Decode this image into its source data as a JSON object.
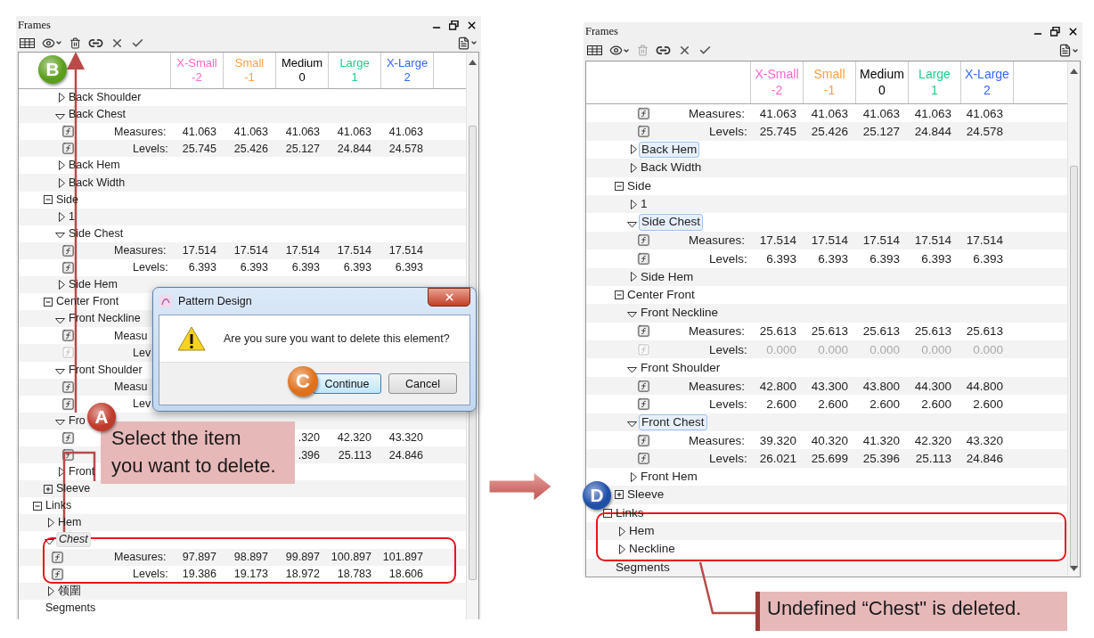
{
  "panels": [
    {
      "title": "Frames",
      "toolbar": [
        {
          "kind": "columns"
        },
        {
          "kind": "view"
        },
        {
          "kind": "delete",
          "disabled": false
        },
        {
          "kind": "link"
        },
        {
          "kind": "cancel"
        },
        {
          "kind": "apply"
        }
      ],
      "columns": [
        {
          "label": "X-Small",
          "sub": "-2",
          "color": "#ff66cc"
        },
        {
          "label": "Small",
          "sub": "-1",
          "color": "#ffa040"
        },
        {
          "label": "Medium",
          "sub": "0",
          "color": "#000000"
        },
        {
          "label": "Large",
          "sub": "1",
          "color": "#22cc88"
        },
        {
          "label": "X-Large",
          "sub": "2",
          "color": "#3366ff"
        }
      ],
      "tree": [
        {
          "kind": "group",
          "children": [
            {
              "kind": "group",
              "children": [
                {
                  "kind": "item",
                  "label": "Back Shoulder",
                  "expanded": false
                },
                {
                  "kind": "item",
                  "label": "Back Chest",
                  "expanded": true,
                  "children": [
                    {
                      "kind": "measures",
                      "label": "Measures:",
                      "disabled": false,
                      "values": [
                        "41.063",
                        "41.063",
                        "41.063",
                        "41.063",
                        "41.063"
                      ]
                    },
                    {
                      "kind": "levels",
                      "label": "Levels:",
                      "disabled": false,
                      "values": [
                        "25.745",
                        "25.426",
                        "25.127",
                        "24.844",
                        "24.578"
                      ]
                    }
                  ]
                },
                {
                  "kind": "item",
                  "label": "Back Hem",
                  "expanded": false
                },
                {
                  "kind": "item",
                  "label": "Back Width",
                  "expanded": false
                }
              ]
            },
            {
              "kind": "section",
              "label": "Side",
              "expanded": true,
              "children": [
                {
                  "kind": "item",
                  "label": "1",
                  "expanded": false
                },
                {
                  "kind": "item",
                  "label": "Side Chest",
                  "expanded": true,
                  "children": [
                    {
                      "kind": "measures",
                      "label": "Measures:",
                      "disabled": false,
                      "values": [
                        "17.514",
                        "17.514",
                        "17.514",
                        "17.514",
                        "17.514"
                      ]
                    },
                    {
                      "kind": "levels",
                      "label": "Levels:",
                      "disabled": false,
                      "values": [
                        "6.393",
                        "6.393",
                        "6.393",
                        "6.393",
                        "6.393"
                      ]
                    }
                  ]
                },
                {
                  "kind": "item",
                  "label": "Side Hem",
                  "expanded": false
                }
              ]
            },
            {
              "kind": "section",
              "label": "Center Front",
              "expanded": true,
              "children": [
                {
                  "kind": "item",
                  "label": "Front Neckline",
                  "expanded": true,
                  "children": [
                    {
                      "kind": "measures",
                      "label": "Measu",
                      "disabled": false
                    },
                    {
                      "kind": "levels",
                      "label": "Lev",
                      "disabled": true
                    }
                  ]
                },
                {
                  "kind": "item",
                  "label": "Front Shoulder",
                  "expanded": true,
                  "children": [
                    {
                      "kind": "measures",
                      "label": "Measu",
                      "disabled": false
                    },
                    {
                      "kind": "levels",
                      "label": "Lev",
                      "disabled": false
                    }
                  ]
                },
                {
                  "kind": "item",
                  "label": "Fro",
                  "expanded": true,
                  "children": [
                    {
                      "kind": "measures",
                      "disabled": false,
                      "values": [
                        ".320",
                        "42.320",
                        "43.320"
                      ]
                    },
                    {
                      "kind": "levels",
                      "disabled": false,
                      "values": [
                        ".396",
                        "25.113",
                        "24.846"
                      ]
                    }
                  ]
                },
                {
                  "kind": "item",
                  "label": "Front",
                  "expanded": false
                }
              ]
            },
            {
              "kind": "section",
              "label": "Sleeve",
              "expanded": false
            }
          ]
        },
        {
          "kind": "section",
          "label": "Links",
          "expanded": true,
          "children": [
            {
              "kind": "item",
              "label": "Hem",
              "expanded": false
            },
            {
              "kind": "item",
              "label": "Chest",
              "expanded": true,
              "undefined": true,
              "highlighted": true,
              "children": [
                {
                  "kind": "measures",
                  "label": "Measures:",
                  "disabled": false,
                  "values": [
                    "97.897",
                    "98.897",
                    "99.897",
                    "100.897",
                    "101.897"
                  ]
                },
                {
                  "kind": "levels",
                  "label": "Levels:",
                  "disabled": false,
                  "values": [
                    "19.386",
                    "19.173",
                    "18.972",
                    "18.783",
                    "18.606"
                  ]
                }
              ]
            },
            {
              "kind": "item",
              "label": "领圍",
              "expanded": false
            }
          ]
        },
        {
          "kind": "plain",
          "label": "Segments"
        }
      ],
      "dialog": {
        "title": "Pattern Design",
        "message": "Are you sure you want to delete this element?",
        "buttons": [
          {
            "label": "Continue",
            "default": true
          },
          {
            "label": "Cancel",
            "default": false
          }
        ]
      },
      "markers": [
        {
          "letter": "B",
          "color": "#5a9e1a"
        },
        {
          "letter": "A",
          "color": "#c0392b"
        },
        {
          "letter": "C",
          "color": "#e0701a"
        }
      ],
      "callout": "Select the item\nyou want to delete."
    },
    {
      "title": "Frames",
      "toolbar": [
        {
          "kind": "columns"
        },
        {
          "kind": "view"
        },
        {
          "kind": "delete",
          "disabled": true
        },
        {
          "kind": "link"
        },
        {
          "kind": "cancel"
        },
        {
          "kind": "apply"
        }
      ],
      "columns": [
        {
          "label": "X-Small",
          "sub": "-2",
          "color": "#ff66cc"
        },
        {
          "label": "Small",
          "sub": "-1",
          "color": "#ffa040"
        },
        {
          "label": "Medium",
          "sub": "0",
          "color": "#000000"
        },
        {
          "label": "Large",
          "sub": "1",
          "color": "#22cc88"
        },
        {
          "label": "X-Large",
          "sub": "2",
          "color": "#3366ff"
        }
      ],
      "tree": [
        {
          "kind": "group",
          "children": [
            {
              "kind": "group",
              "children": [
                {
                  "kind": "group",
                  "children": [
                    {
                      "kind": "measures",
                      "label": "Measures:",
                      "disabled": false,
                      "values": [
                        "41.063",
                        "41.063",
                        "41.063",
                        "41.063",
                        "41.063"
                      ]
                    },
                    {
                      "kind": "levels",
                      "label": "Levels:",
                      "disabled": false,
                      "values": [
                        "25.745",
                        "25.426",
                        "25.127",
                        "24.844",
                        "24.578"
                      ]
                    }
                  ]
                },
                {
                  "kind": "item",
                  "label": "Back Hem",
                  "expanded": false,
                  "highlighted": true
                },
                {
                  "kind": "item",
                  "label": "Back Width",
                  "expanded": false
                }
              ]
            },
            {
              "kind": "section",
              "label": "Side",
              "expanded": true,
              "children": [
                {
                  "kind": "item",
                  "label": "1",
                  "expanded": false
                },
                {
                  "kind": "item",
                  "label": "Side Chest",
                  "expanded": true,
                  "highlighted": true,
                  "children": [
                    {
                      "kind": "measures",
                      "label": "Measures:",
                      "disabled": false,
                      "values": [
                        "17.514",
                        "17.514",
                        "17.514",
                        "17.514",
                        "17.514"
                      ]
                    },
                    {
                      "kind": "levels",
                      "label": "Levels:",
                      "disabled": false,
                      "values": [
                        "6.393",
                        "6.393",
                        "6.393",
                        "6.393",
                        "6.393"
                      ]
                    }
                  ]
                },
                {
                  "kind": "item",
                  "label": "Side Hem",
                  "expanded": false
                }
              ]
            },
            {
              "kind": "section",
              "label": "Center Front",
              "expanded": true,
              "children": [
                {
                  "kind": "item",
                  "label": "Front Neckline",
                  "expanded": true,
                  "children": [
                    {
                      "kind": "measures",
                      "label": "Measures:",
                      "disabled": false,
                      "values": [
                        "25.613",
                        "25.613",
                        "25.613",
                        "25.613",
                        "25.613"
                      ]
                    },
                    {
                      "kind": "levels",
                      "label": "Levels:",
                      "disabled": true,
                      "values": [
                        "0.000",
                        "0.000",
                        "0.000",
                        "0.000",
                        "0.000"
                      ]
                    }
                  ]
                },
                {
                  "kind": "item",
                  "label": "Front Shoulder",
                  "expanded": true,
                  "children": [
                    {
                      "kind": "measures",
                      "label": "Measures:",
                      "disabled": false,
                      "values": [
                        "42.800",
                        "43.300",
                        "43.800",
                        "44.300",
                        "44.800"
                      ]
                    },
                    {
                      "kind": "levels",
                      "label": "Levels:",
                      "disabled": false,
                      "values": [
                        "2.600",
                        "2.600",
                        "2.600",
                        "2.600",
                        "2.600"
                      ]
                    }
                  ]
                },
                {
                  "kind": "item",
                  "label": "Front Chest",
                  "expanded": true,
                  "highlighted": true,
                  "children": [
                    {
                      "kind": "measures",
                      "label": "Measures:",
                      "disabled": false,
                      "values": [
                        "39.320",
                        "40.320",
                        "41.320",
                        "42.320",
                        "43.320"
                      ]
                    },
                    {
                      "kind": "levels",
                      "label": "Levels:",
                      "disabled": false,
                      "values": [
                        "26.021",
                        "25.699",
                        "25.396",
                        "25.113",
                        "24.846"
                      ]
                    }
                  ]
                },
                {
                  "kind": "item",
                  "label": "Front Hem",
                  "expanded": false
                }
              ]
            },
            {
              "kind": "section",
              "label": "Sleeve",
              "expanded": false
            }
          ]
        },
        {
          "kind": "section",
          "label": "Links",
          "expanded": true,
          "children": [
            {
              "kind": "item",
              "label": "Hem",
              "expanded": false
            },
            {
              "kind": "item",
              "label": "Neckline",
              "expanded": false
            }
          ]
        },
        {
          "kind": "plain",
          "label": "Segments"
        }
      ],
      "markers": [
        {
          "letter": "D",
          "color": "#1f4fa8"
        }
      ],
      "callout": "Undefined “Chest\" is deleted."
    }
  ]
}
